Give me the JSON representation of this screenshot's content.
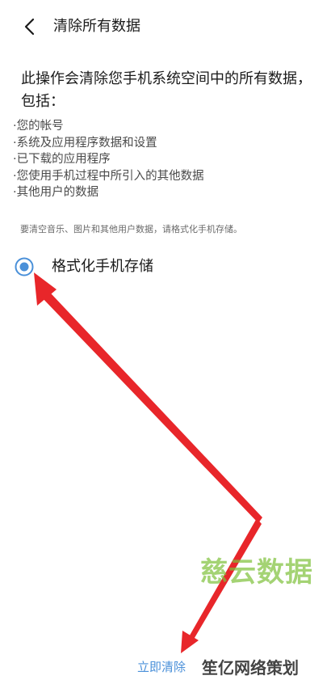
{
  "header": {
    "title": "清除所有数据",
    "back_icon": "chevron-left-icon"
  },
  "intro": {
    "text": "此操作会清除您手机系统空间中的所有数据，包括："
  },
  "items": [
    "·您的帐号",
    "·系统及应用程序数据和设置",
    "·已下载的应用程序",
    "·您使用手机过程中所引入的其他数据",
    "·其他用户的数据"
  ],
  "hint": "要清空音乐、图片和其他用户数据，请格式化手机存储。",
  "option": {
    "label": "格式化手机存储",
    "selected": true
  },
  "footer": {
    "clear_label": "立即清除"
  },
  "watermark": "慈云数据",
  "brand": "笙亿网络策划",
  "colors": {
    "accent": "#4a90d9",
    "arrow": "#e8262a",
    "watermark": "#7ec13a"
  }
}
